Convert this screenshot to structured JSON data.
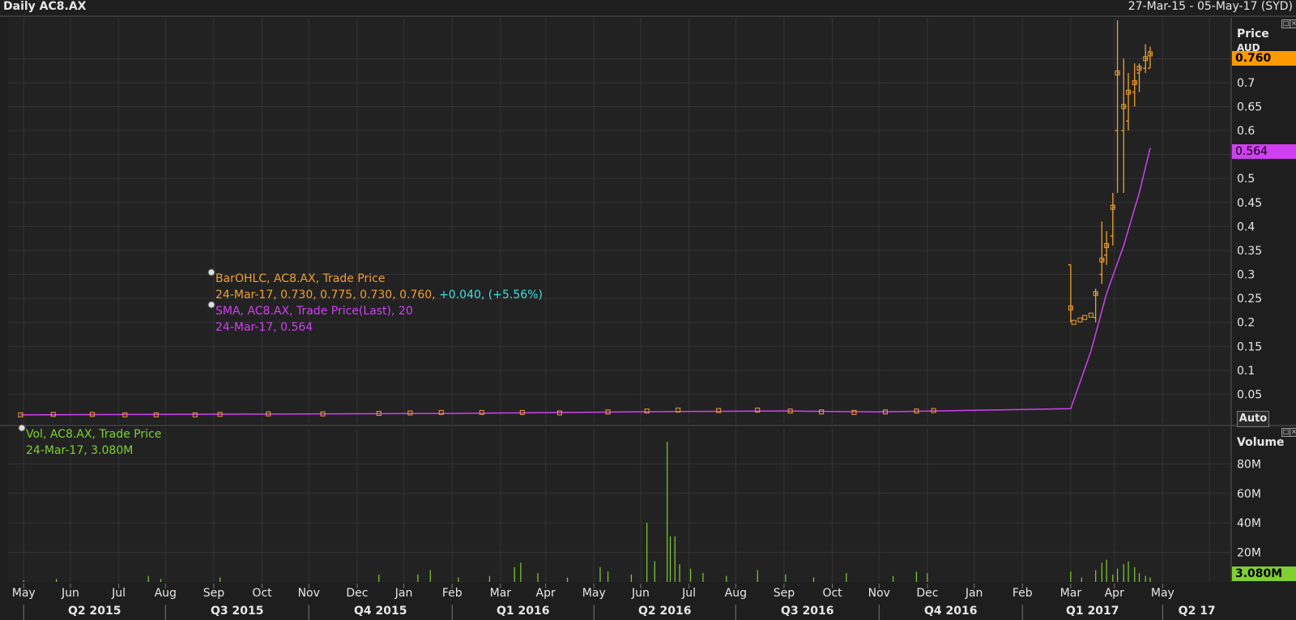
{
  "header": {
    "title": "Daily AC8.AX",
    "date_range": "27-Mar-15 - 05-May-17 (SYD)"
  },
  "price_axis": {
    "title": "Price",
    "unit": "AUD",
    "last_price_label": "0.760",
    "sma_label": "0.564",
    "auto_label": "Auto"
  },
  "volume_axis": {
    "title": "Volume",
    "last_volume_label": "3.080M"
  },
  "legend": {
    "ohlc_title": "BarOHLC, AC8.AX, Trade Price",
    "ohlc_values": "24-Mar-17, 0.730, 0.775, 0.730, 0.760,",
    "ohlc_change": "+0.040, (+5.56%)",
    "sma_title": "SMA, AC8.AX, Trade Price(Last),",
    "sma_period": "20",
    "sma_values": "24-Mar-17, 0.564",
    "vol_title": "Vol, AC8.AX, Trade Price",
    "vol_values": "24-Mar-17, 3.080M"
  },
  "colors": {
    "background": "#1e1e1e",
    "grid": "#333333",
    "ohlc": "#f0a030",
    "sma": "#d040f0",
    "volume": "#7fd030",
    "last_price_bg": "#ff9900",
    "sma_bg": "#d040f0",
    "volume_bg": "#7fd030"
  },
  "chart_data": [
    {
      "type": "bar",
      "subtype": "ohlc",
      "title": "Daily AC8.AX",
      "ylabel": "Price AUD",
      "ylim": [
        0,
        0.83
      ],
      "yticks": [
        0.05,
        0.1,
        0.15,
        0.2,
        0.25,
        0.3,
        0.35,
        0.4,
        0.45,
        0.5,
        0.55,
        0.6,
        0.65,
        0.7,
        0.75
      ],
      "ytick_labels": [
        "0.05",
        "0.1",
        "0.15",
        "0.2",
        "0.25",
        "0.3",
        "0.35",
        "0.4",
        "0.45",
        "0.5",
        "0.55",
        "0.6",
        "0.65",
        "0.7",
        "0.75"
      ],
      "x_month_labels": [
        "Apr",
        "May",
        "Jun",
        "Jul",
        "Aug",
        "Sep",
        "Oct",
        "Nov",
        "Dec",
        "Jan",
        "Feb",
        "Mar",
        "Apr",
        "May",
        "Jun",
        "Jul",
        "Aug",
        "Sep",
        "Oct",
        "Nov",
        "Dec",
        "Jan",
        "Feb",
        "Mar",
        "Apr",
        "May"
      ],
      "x_quarter_labels": [
        "Q2 2015",
        "Q3 2015",
        "Q4 2015",
        "Q1 2016",
        "Q2 2016",
        "Q3 2016",
        "Q4 2016",
        "Q1 2017",
        "Q2 17"
      ],
      "grid": true,
      "series": [
        {
          "name": "BarOHLC, AC8.AX, Trade Price",
          "points": [
            {
              "x": "2015-03-30",
              "close": 0.007
            },
            {
              "x": "2015-04-20",
              "close": 0.008
            },
            {
              "x": "2015-05-15",
              "close": 0.008
            },
            {
              "x": "2015-06-05",
              "close": 0.007
            },
            {
              "x": "2015-06-25",
              "close": 0.007
            },
            {
              "x": "2015-07-20",
              "close": 0.007
            },
            {
              "x": "2015-08-05",
              "close": 0.008
            },
            {
              "x": "2015-09-05",
              "close": 0.009
            },
            {
              "x": "2015-10-10",
              "close": 0.009
            },
            {
              "x": "2015-11-15",
              "close": 0.01
            },
            {
              "x": "2015-12-05",
              "close": 0.011
            },
            {
              "x": "2015-12-25",
              "close": 0.012
            },
            {
              "x": "2016-01-20",
              "close": 0.012
            },
            {
              "x": "2016-02-15",
              "close": 0.012
            },
            {
              "x": "2016-03-10",
              "close": 0.011
            },
            {
              "x": "2016-04-10",
              "close": 0.013
            },
            {
              "x": "2016-05-05",
              "close": 0.015
            },
            {
              "x": "2016-05-25",
              "close": 0.017
            },
            {
              "x": "2016-06-20",
              "close": 0.016
            },
            {
              "x": "2016-07-15",
              "close": 0.017
            },
            {
              "x": "2016-08-05",
              "close": 0.015
            },
            {
              "x": "2016-08-25",
              "close": 0.013
            },
            {
              "x": "2016-09-15",
              "close": 0.012
            },
            {
              "x": "2016-10-05",
              "close": 0.013
            },
            {
              "x": "2016-10-25",
              "close": 0.015
            },
            {
              "x": "2016-11-05",
              "close": 0.016
            },
            {
              "x": "2017-02-01",
              "open": 0.32,
              "high": 0.32,
              "low": 0.2,
              "close": 0.23
            },
            {
              "x": "2017-02-03",
              "close": 0.2
            },
            {
              "x": "2017-02-07",
              "close": 0.205
            },
            {
              "x": "2017-02-10",
              "close": 0.21
            },
            {
              "x": "2017-02-14",
              "close": 0.215
            },
            {
              "x": "2017-02-17",
              "open": 0.21,
              "high": 0.27,
              "low": 0.2,
              "close": 0.26
            },
            {
              "x": "2017-02-21",
              "open": 0.3,
              "high": 0.41,
              "low": 0.28,
              "close": 0.33
            },
            {
              "x": "2017-02-24",
              "open": 0.34,
              "high": 0.39,
              "low": 0.32,
              "close": 0.36
            },
            {
              "x": "2017-02-28",
              "open": 0.38,
              "high": 0.47,
              "low": 0.36,
              "close": 0.44
            },
            {
              "x": "2017-03-03",
              "open": 0.6,
              "high": 0.83,
              "low": 0.47,
              "close": 0.72
            },
            {
              "x": "2017-03-07",
              "open": 0.6,
              "high": 0.75,
              "low": 0.47,
              "close": 0.65
            },
            {
              "x": "2017-03-10",
              "open": 0.62,
              "high": 0.72,
              "low": 0.6,
              "close": 0.68
            },
            {
              "x": "2017-03-14",
              "open": 0.68,
              "high": 0.74,
              "low": 0.65,
              "close": 0.7
            },
            {
              "x": "2017-03-17",
              "open": 0.72,
              "high": 0.74,
              "low": 0.68,
              "close": 0.73
            },
            {
              "x": "2017-03-21",
              "open": 0.73,
              "high": 0.78,
              "low": 0.72,
              "close": 0.75
            },
            {
              "x": "2017-03-24",
              "open": 0.73,
              "high": 0.775,
              "low": 0.73,
              "close": 0.76
            }
          ]
        },
        {
          "name": "SMA, AC8.AX, Trade Price(Last), 20",
          "points": [
            {
              "x": "2015-03-30",
              "y": 0.007
            },
            {
              "x": "2016-01-01",
              "y": 0.01
            },
            {
              "x": "2016-05-25",
              "y": 0.014
            },
            {
              "x": "2016-08-01",
              "y": 0.015
            },
            {
              "x": "2016-10-01",
              "y": 0.013
            },
            {
              "x": "2017-02-01",
              "y": 0.02
            },
            {
              "x": "2017-02-14",
              "y": 0.14
            },
            {
              "x": "2017-02-24",
              "y": 0.26
            },
            {
              "x": "2017-03-07",
              "y": 0.36
            },
            {
              "x": "2017-03-17",
              "y": 0.47
            },
            {
              "x": "2017-03-24",
              "y": 0.564
            }
          ]
        }
      ]
    },
    {
      "type": "bar",
      "title": "Vol, AC8.AX, Trade Price",
      "ylabel": "Volume",
      "ylim": [
        0,
        100
      ],
      "yticks": [
        20,
        40,
        60,
        80
      ],
      "ytick_labels": [
        "20M",
        "40M",
        "60M",
        "80M"
      ],
      "series": [
        {
          "name": "Vol, AC8.AX, Trade Price",
          "points": [
            {
              "x": "2015-04-01",
              "y": 1
            },
            {
              "x": "2015-04-22",
              "y": 2
            },
            {
              "x": "2015-06-20",
              "y": 4
            },
            {
              "x": "2015-06-28",
              "y": 2
            },
            {
              "x": "2015-08-05",
              "y": 3
            },
            {
              "x": "2015-11-15",
              "y": 5
            },
            {
              "x": "2015-12-10",
              "y": 5
            },
            {
              "x": "2015-12-18",
              "y": 8
            },
            {
              "x": "2016-01-05",
              "y": 3
            },
            {
              "x": "2016-01-25",
              "y": 4
            },
            {
              "x": "2016-02-10",
              "y": 10
            },
            {
              "x": "2016-02-14",
              "y": 13
            },
            {
              "x": "2016-02-25",
              "y": 6
            },
            {
              "x": "2016-03-15",
              "y": 3
            },
            {
              "x": "2016-04-05",
              "y": 10
            },
            {
              "x": "2016-04-10",
              "y": 7
            },
            {
              "x": "2016-04-25",
              "y": 5
            },
            {
              "x": "2016-05-05",
              "y": 40
            },
            {
              "x": "2016-05-10",
              "y": 14
            },
            {
              "x": "2016-05-18",
              "y": 95
            },
            {
              "x": "2016-05-20",
              "y": 31
            },
            {
              "x": "2016-05-23",
              "y": 31
            },
            {
              "x": "2016-05-26",
              "y": 12
            },
            {
              "x": "2016-06-02",
              "y": 9
            },
            {
              "x": "2016-06-10",
              "y": 6
            },
            {
              "x": "2016-06-25",
              "y": 4
            },
            {
              "x": "2016-07-15",
              "y": 8
            },
            {
              "x": "2016-08-02",
              "y": 5
            },
            {
              "x": "2016-08-20",
              "y": 3
            },
            {
              "x": "2016-09-10",
              "y": 6
            },
            {
              "x": "2016-10-10",
              "y": 4
            },
            {
              "x": "2016-10-25",
              "y": 7
            },
            {
              "x": "2016-11-01",
              "y": 6
            },
            {
              "x": "2017-02-01",
              "y": 7
            },
            {
              "x": "2017-02-08",
              "y": 3
            },
            {
              "x": "2017-02-17",
              "y": 8
            },
            {
              "x": "2017-02-21",
              "y": 13
            },
            {
              "x": "2017-02-24",
              "y": 15
            },
            {
              "x": "2017-02-28",
              "y": 5
            },
            {
              "x": "2017-03-03",
              "y": 9
            },
            {
              "x": "2017-03-07",
              "y": 12
            },
            {
              "x": "2017-03-10",
              "y": 14
            },
            {
              "x": "2017-03-14",
              "y": 10
            },
            {
              "x": "2017-03-17",
              "y": 6
            },
            {
              "x": "2017-03-21",
              "y": 4
            },
            {
              "x": "2017-03-24",
              "y": 3.08
            }
          ]
        }
      ]
    }
  ]
}
